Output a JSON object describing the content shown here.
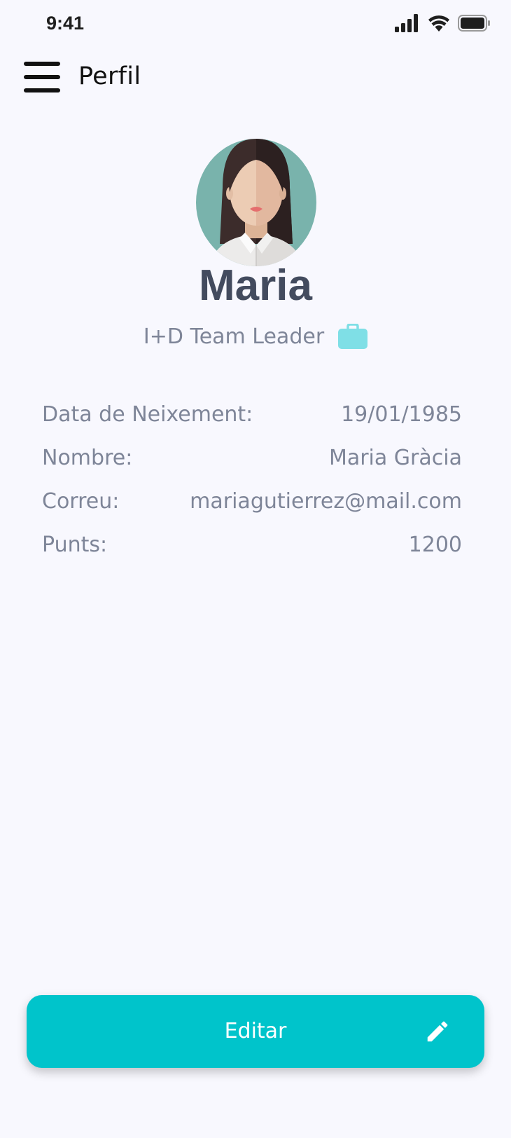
{
  "status_bar": {
    "time": "9:41"
  },
  "header": {
    "title": "Perfil"
  },
  "profile": {
    "name": "Maria",
    "role": "I+D Team Leader"
  },
  "details": [
    {
      "label": "Data de Neixement:",
      "value": "19/01/1985"
    },
    {
      "label": "Nombre:",
      "value": "Maria Gràcia"
    },
    {
      "label": "Correu:",
      "value": "mariagutierrez@mail.com"
    },
    {
      "label": "Punts:",
      "value": "1200"
    }
  ],
  "actions": {
    "edit_label": "Editar"
  },
  "icons": {
    "menu": "hamburger-menu-icon",
    "role": "briefcase-icon",
    "edit": "pencil-icon",
    "signal": "signal-icon",
    "wifi": "wifi-icon",
    "battery": "battery-icon"
  },
  "colors": {
    "background": "#f8f8fe",
    "accent": "#00c4cb",
    "briefcase": "#7fdfe6",
    "name_text": "#434b5e",
    "secondary_text": "#7e8598"
  }
}
